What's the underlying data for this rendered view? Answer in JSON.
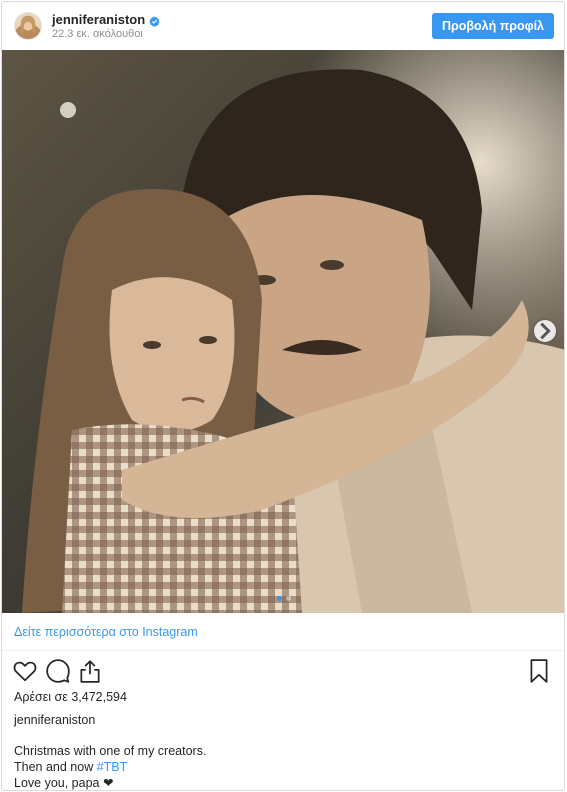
{
  "header": {
    "username": "jenniferaniston",
    "followers": "22.3 εκ. ακόλουθοι",
    "view_profile_label": "Προβολή προφίλ"
  },
  "see_more": "Δείτε περισσότερα στο Instagram",
  "likes": "Αρέσει σε 3,472,594",
  "caption": {
    "username": "jenniferaniston",
    "line1": "Christmas with one of my creators.",
    "line2_prefix": "Then and now ",
    "hashtag": "#TBT",
    "line3": "Love you, papa ❤"
  },
  "carousel": {
    "total_slides": 2,
    "active_slide": 1
  },
  "icons": {
    "verified": "verified-badge-icon",
    "like": "heart-icon",
    "comment": "comment-icon",
    "share": "share-icon",
    "save": "bookmark-icon",
    "next": "chevron-right-icon"
  },
  "colors": {
    "accent": "#3897f0",
    "text": "#262626",
    "muted": "#8e8e8e"
  }
}
